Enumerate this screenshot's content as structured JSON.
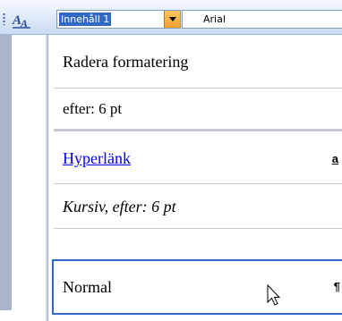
{
  "toolbar": {
    "style_value": "Innehåll 1",
    "font_value": "Arial"
  },
  "style_menu": {
    "items": [
      {
        "label": "Radera formatering",
        "marker": ""
      },
      {
        "label": "efter:  6 pt",
        "marker": ""
      },
      {
        "label": "Hyperlänk",
        "marker": "a"
      },
      {
        "label": "Kursiv, efter:  6 pt",
        "marker": ""
      },
      {
        "label": "Normal",
        "marker": "¶"
      }
    ]
  },
  "colors": {
    "selection_blue": "#316ac5",
    "combo_arrow_orange": "#f8a02e",
    "link_blue": "#0000ee"
  },
  "icons": {
    "styles": "styles-formatting-icon",
    "arrow": "chevron-down-icon",
    "pointer": "mouse-pointer-icon"
  }
}
